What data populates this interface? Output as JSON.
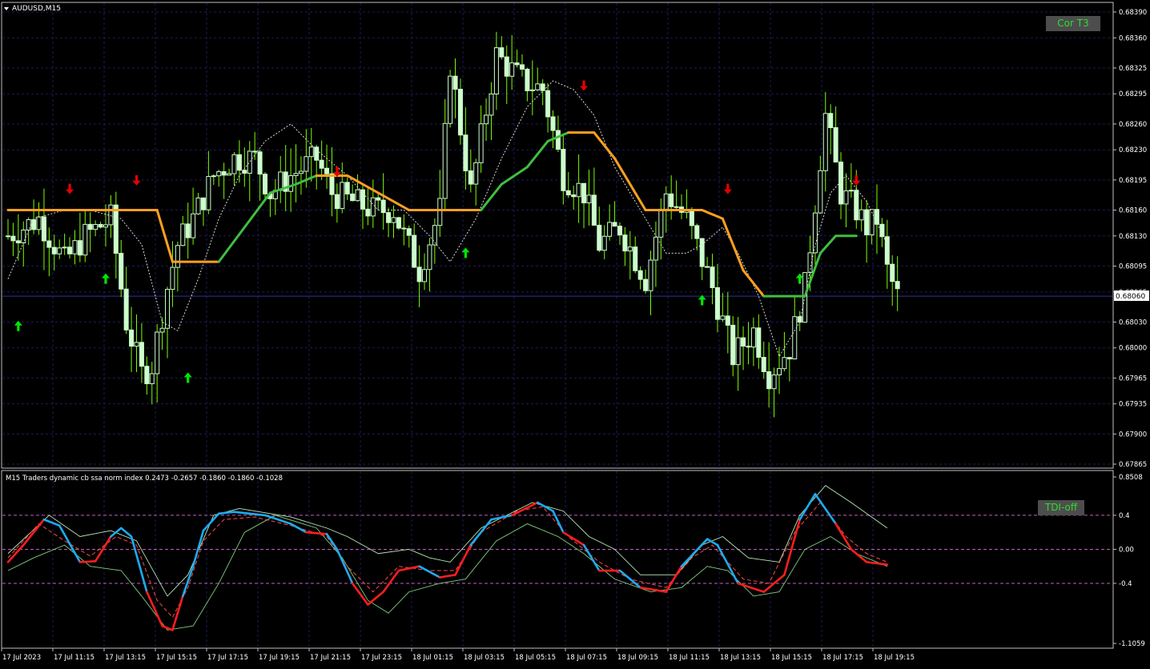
{
  "window": {
    "title": "AUDUSD,M15"
  },
  "buttons": {
    "cor_t3": "Cor T3",
    "tdi_off": "TDI-off"
  },
  "colors": {
    "background": "#000000",
    "grid": "#1b1b5a",
    "frame": "#c0c0c0",
    "candle": "#ccffcc",
    "wick": "#7cfc00",
    "t3_up": "#3fbf3f",
    "t3_down": "#ffa020",
    "arrow_up": "#00e600",
    "arrow_down": "#e60000",
    "tdi_blue": "#1eaaf0",
    "tdi_red": "#ff1e1e"
  },
  "chart_data": [
    {
      "type": "candlestick",
      "title": "AUDUSD,M15",
      "ylim": [
        0.67865,
        0.6839
      ],
      "y_ticks": [
        "0.68390",
        "0.68360",
        "0.68325",
        "0.68295",
        "0.68260",
        "0.68230",
        "0.68195",
        "0.68160",
        "0.68130",
        "0.68095",
        "0.68065",
        "0.68030",
        "0.68000",
        "0.67965",
        "0.67935",
        "0.67900",
        "0.67865"
      ],
      "current_price": "0.68060",
      "x_ticks": [
        "17 Jul 2023",
        "17 Jul 11:15",
        "17 Jul 13:15",
        "17 Jul 15:15",
        "17 Jul 17:15",
        "17 Jul 19:15",
        "17 Jul 21:15",
        "17 Jul 23:15",
        "18 Jul 01:15",
        "18 Jul 03:15",
        "18 Jul 05:15",
        "18 Jul 07:15",
        "18 Jul 09:15",
        "18 Jul 11:15",
        "18 Jul 13:15",
        "18 Jul 15:15",
        "18 Jul 17:15",
        "18 Jul 19:15"
      ],
      "close_path": [
        [
          0,
          0.6813
        ],
        [
          6,
          0.6815
        ],
        [
          11,
          0.681
        ],
        [
          15,
          0.6813
        ],
        [
          20,
          0.6815
        ],
        [
          23,
          0.6803
        ],
        [
          26,
          0.6797
        ],
        [
          28,
          0.6798
        ],
        [
          31,
          0.6807
        ],
        [
          33,
          0.6812
        ],
        [
          36,
          0.6815
        ],
        [
          40,
          0.682
        ],
        [
          44,
          0.6822
        ],
        [
          48,
          0.6822
        ],
        [
          51,
          0.6818
        ],
        [
          55,
          0.682
        ],
        [
          60,
          0.6822
        ],
        [
          63,
          0.6818
        ],
        [
          67,
          0.6817
        ],
        [
          71,
          0.6816
        ],
        [
          75,
          0.6816
        ],
        [
          77,
          0.6813
        ],
        [
          80,
          0.6809
        ],
        [
          84,
          0.6816
        ],
        [
          86,
          0.6833
        ],
        [
          90,
          0.6818
        ],
        [
          95,
          0.6834
        ],
        [
          100,
          0.6831
        ],
        [
          104,
          0.683
        ],
        [
          108,
          0.682
        ],
        [
          112,
          0.6818
        ],
        [
          115,
          0.6812
        ],
        [
          119,
          0.6814
        ],
        [
          124,
          0.6808
        ],
        [
          128,
          0.6818
        ],
        [
          132,
          0.6815
        ],
        [
          137,
          0.6807
        ],
        [
          141,
          0.6799
        ],
        [
          145,
          0.6802
        ],
        [
          148,
          0.6797
        ],
        [
          152,
          0.68
        ],
        [
          155,
          0.6807
        ],
        [
          159,
          0.6827
        ],
        [
          162,
          0.6818
        ],
        [
          165,
          0.6816
        ],
        [
          167,
          0.6814
        ],
        [
          169,
          0.6815
        ],
        [
          171,
          0.6809
        ],
        [
          173,
          0.6806
        ]
      ],
      "t3_line": [
        [
          0,
          0.6816,
          "down"
        ],
        [
          29,
          0.6816,
          "down"
        ],
        [
          32,
          0.681,
          "down"
        ],
        [
          41,
          0.681,
          "up"
        ],
        [
          51,
          0.6818,
          "up"
        ],
        [
          56,
          0.6819,
          "up"
        ],
        [
          60,
          0.682,
          "down"
        ],
        [
          66,
          0.682,
          "down"
        ],
        [
          72,
          0.6818,
          "down"
        ],
        [
          78,
          0.6816,
          "down"
        ],
        [
          83,
          0.6816,
          "down"
        ],
        [
          92,
          0.6816,
          "up"
        ],
        [
          96,
          0.6819,
          "up"
        ],
        [
          101,
          0.6821,
          "up"
        ],
        [
          105,
          0.6824,
          "up"
        ],
        [
          109,
          0.6825,
          "down"
        ],
        [
          114,
          0.6825,
          "down"
        ],
        [
          118,
          0.6822,
          "down"
        ],
        [
          124,
          0.6816,
          "down"
        ],
        [
          133,
          0.6816,
          "down"
        ],
        [
          135,
          0.6816,
          "down"
        ],
        [
          139,
          0.6815,
          "down"
        ],
        [
          143,
          0.6809,
          "down"
        ],
        [
          147,
          0.6806,
          "up"
        ],
        [
          152,
          0.6806,
          "up"
        ],
        [
          155,
          0.6806,
          "up"
        ],
        [
          158,
          0.6811,
          "up"
        ],
        [
          161,
          0.6813,
          "up"
        ],
        [
          165,
          0.6813,
          "up"
        ]
      ],
      "dotted_ma": [
        [
          0,
          0.6808
        ],
        [
          5,
          0.6815
        ],
        [
          11,
          0.6816
        ],
        [
          16,
          0.6816
        ],
        [
          22,
          0.6815
        ],
        [
          26,
          0.6812
        ],
        [
          30,
          0.6803
        ],
        [
          33,
          0.6802
        ],
        [
          37,
          0.6808
        ],
        [
          41,
          0.6815
        ],
        [
          45,
          0.682
        ],
        [
          50,
          0.6824
        ],
        [
          55,
          0.6826
        ],
        [
          60,
          0.6823
        ],
        [
          66,
          0.682
        ],
        [
          72,
          0.6816
        ],
        [
          77,
          0.6816
        ],
        [
          82,
          0.6813
        ],
        [
          86,
          0.681
        ],
        [
          91,
          0.6815
        ],
        [
          96,
          0.6822
        ],
        [
          101,
          0.6828
        ],
        [
          106,
          0.6831
        ],
        [
          110,
          0.683
        ],
        [
          114,
          0.6827
        ],
        [
          118,
          0.6821
        ],
        [
          124,
          0.6815
        ],
        [
          128,
          0.6811
        ],
        [
          132,
          0.6811
        ],
        [
          135,
          0.6812
        ],
        [
          139,
          0.6814
        ],
        [
          142,
          0.6811
        ],
        [
          146,
          0.6806
        ],
        [
          150,
          0.6799
        ],
        [
          154,
          0.6803
        ],
        [
          157,
          0.6812
        ],
        [
          160,
          0.6818
        ],
        [
          163,
          0.682
        ],
        [
          167,
          0.6817
        ],
        [
          171,
          0.6812
        ]
      ],
      "arrows_up": [
        [
          2,
          0.68025
        ],
        [
          19,
          0.6808
        ],
        [
          35,
          0.67965
        ],
        [
          89,
          0.6811
        ],
        [
          135,
          0.68055
        ],
        [
          154,
          0.6808
        ]
      ],
      "arrows_down": [
        [
          12,
          0.68185
        ],
        [
          25,
          0.68195
        ],
        [
          64,
          0.68205
        ],
        [
          112,
          0.68305
        ],
        [
          140,
          0.68185
        ],
        [
          165,
          0.68195
        ]
      ]
    },
    {
      "type": "line",
      "title": "M15  Traders dynamic cb ssa norm index 0.2473 -0.2657 -0.1860 -0.1860 -0.1028",
      "ylim": [
        -1.1059,
        0.8508
      ],
      "y_ticks": [
        "0.8508",
        "0.4",
        "0.00",
        "-0.4",
        "-1.1059"
      ],
      "levels": [
        0.4,
        0.0,
        -0.4
      ],
      "main": [
        [
          0,
          -0.15
        ],
        [
          3,
          0.05
        ],
        [
          7,
          0.35
        ],
        [
          10,
          0.28
        ],
        [
          14,
          -0.15
        ],
        [
          17,
          -0.14
        ],
        [
          20,
          0.15
        ],
        [
          22,
          0.25
        ],
        [
          24,
          0.15
        ],
        [
          27,
          -0.5
        ],
        [
          30,
          -0.9
        ],
        [
          32,
          -0.95
        ],
        [
          34,
          -0.55
        ],
        [
          36,
          -0.2
        ],
        [
          38,
          0.22
        ],
        [
          41,
          0.42
        ],
        [
          44,
          0.44
        ],
        [
          50,
          0.4
        ],
        [
          55,
          0.3
        ],
        [
          58,
          0.2
        ],
        [
          62,
          0.18
        ],
        [
          64,
          0.0
        ],
        [
          67,
          -0.4
        ],
        [
          70,
          -0.65
        ],
        [
          73,
          -0.5
        ],
        [
          76,
          -0.25
        ],
        [
          80,
          -0.2
        ],
        [
          84,
          -0.33
        ],
        [
          87,
          -0.3
        ],
        [
          90,
          0.05
        ],
        [
          94,
          0.35
        ],
        [
          98,
          0.4
        ],
        [
          103,
          0.55
        ],
        [
          106,
          0.45
        ],
        [
          108,
          0.2
        ],
        [
          112,
          0.05
        ],
        [
          115,
          -0.25
        ],
        [
          119,
          -0.25
        ],
        [
          123,
          -0.45
        ],
        [
          128,
          -0.5
        ],
        [
          131,
          -0.2
        ],
        [
          136,
          0.12
        ],
        [
          138,
          0.05
        ],
        [
          142,
          -0.4
        ],
        [
          147,
          -0.5
        ],
        [
          151,
          -0.3
        ],
        [
          154,
          0.35
        ],
        [
          157,
          0.65
        ],
        [
          161,
          0.3
        ],
        [
          164,
          0.0
        ],
        [
          167,
          -0.15
        ],
        [
          171,
          -0.18
        ]
      ],
      "signal": [
        [
          0,
          -0.1
        ],
        [
          6,
          0.3
        ],
        [
          11,
          0.1
        ],
        [
          16,
          -0.08
        ],
        [
          21,
          0.15
        ],
        [
          25,
          0.05
        ],
        [
          29,
          -0.6
        ],
        [
          32,
          -0.8
        ],
        [
          35,
          -0.45
        ],
        [
          38,
          0.1
        ],
        [
          42,
          0.35
        ],
        [
          48,
          0.38
        ],
        [
          55,
          0.28
        ],
        [
          62,
          0.15
        ],
        [
          66,
          -0.2
        ],
        [
          71,
          -0.5
        ],
        [
          76,
          -0.2
        ],
        [
          82,
          -0.25
        ],
        [
          87,
          -0.25
        ],
        [
          92,
          0.2
        ],
        [
          99,
          0.45
        ],
        [
          104,
          0.5
        ],
        [
          109,
          0.15
        ],
        [
          115,
          -0.15
        ],
        [
          121,
          -0.35
        ],
        [
          128,
          -0.45
        ],
        [
          133,
          -0.1
        ],
        [
          137,
          0.05
        ],
        [
          143,
          -0.35
        ],
        [
          148,
          -0.4
        ],
        [
          153,
          0.2
        ],
        [
          158,
          0.55
        ],
        [
          163,
          0.15
        ],
        [
          167,
          -0.05
        ],
        [
          171,
          -0.15
        ]
      ],
      "band_upper": [
        [
          0,
          -0.05
        ],
        [
          8,
          0.4
        ],
        [
          14,
          0.15
        ],
        [
          20,
          0.22
        ],
        [
          25,
          0.1
        ],
        [
          31,
          -0.55
        ],
        [
          35,
          -0.3
        ],
        [
          40,
          0.4
        ],
        [
          45,
          0.48
        ],
        [
          55,
          0.38
        ],
        [
          62,
          0.25
        ],
        [
          66,
          0.15
        ],
        [
          72,
          -0.05
        ],
        [
          78,
          0.0
        ],
        [
          82,
          -0.1
        ],
        [
          86,
          -0.15
        ],
        [
          92,
          0.25
        ],
        [
          102,
          0.55
        ],
        [
          108,
          0.45
        ],
        [
          113,
          0.15
        ],
        [
          118,
          0.0
        ],
        [
          123,
          -0.3
        ],
        [
          130,
          -0.3
        ],
        [
          135,
          0.05
        ],
        [
          139,
          0.15
        ],
        [
          144,
          -0.1
        ],
        [
          150,
          -0.15
        ],
        [
          154,
          0.4
        ],
        [
          159,
          0.75
        ],
        [
          164,
          0.55
        ],
        [
          171,
          0.25
        ]
      ],
      "band_lower": [
        [
          0,
          -0.25
        ],
        [
          5,
          -0.1
        ],
        [
          11,
          0.05
        ],
        [
          16,
          -0.2
        ],
        [
          22,
          -0.25
        ],
        [
          26,
          -0.55
        ],
        [
          31,
          -0.95
        ],
        [
          36,
          -0.9
        ],
        [
          41,
          -0.4
        ],
        [
          46,
          0.2
        ],
        [
          52,
          0.4
        ],
        [
          60,
          0.25
        ],
        [
          65,
          -0.1
        ],
        [
          70,
          -0.6
        ],
        [
          74,
          -0.75
        ],
        [
          78,
          -0.5
        ],
        [
          84,
          -0.4
        ],
        [
          89,
          -0.35
        ],
        [
          95,
          0.1
        ],
        [
          101,
          0.3
        ],
        [
          107,
          0.15
        ],
        [
          112,
          -0.05
        ],
        [
          118,
          -0.35
        ],
        [
          125,
          -0.5
        ],
        [
          131,
          -0.45
        ],
        [
          136,
          -0.2
        ],
        [
          140,
          -0.25
        ],
        [
          145,
          -0.55
        ],
        [
          150,
          -0.5
        ],
        [
          155,
          0.0
        ],
        [
          160,
          0.15
        ],
        [
          165,
          -0.05
        ],
        [
          171,
          -0.2
        ]
      ]
    }
  ]
}
